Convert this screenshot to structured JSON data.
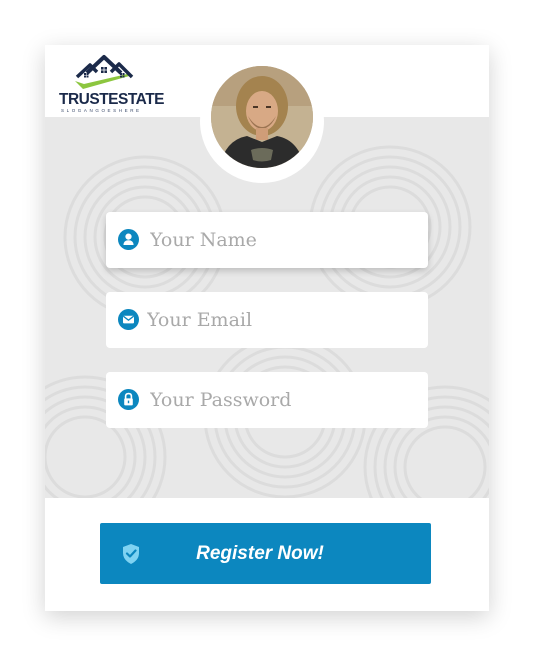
{
  "brand": {
    "name": "TRUSTESTATE",
    "slogan": "SLOGANGOESHERE",
    "colors": {
      "navy": "#1b2a4a",
      "green": "#8cc63f"
    }
  },
  "profile": {
    "avatar_icon": "user-photo"
  },
  "form": {
    "name_field": {
      "placeholder": "Your Name",
      "value": "",
      "icon": "user-icon"
    },
    "email_field": {
      "placeholder": "Your Email",
      "value": "",
      "icon": "envelope-icon"
    },
    "password_field": {
      "placeholder": "Your Password",
      "value": "",
      "icon": "lock-icon"
    }
  },
  "register_button": {
    "label": "Register Now!",
    "icon": "shield-check-icon"
  },
  "colors": {
    "accent": "#0c87bf",
    "background": "#e8e8e8",
    "card": "#ffffff",
    "placeholder": "#a9a9a9"
  }
}
